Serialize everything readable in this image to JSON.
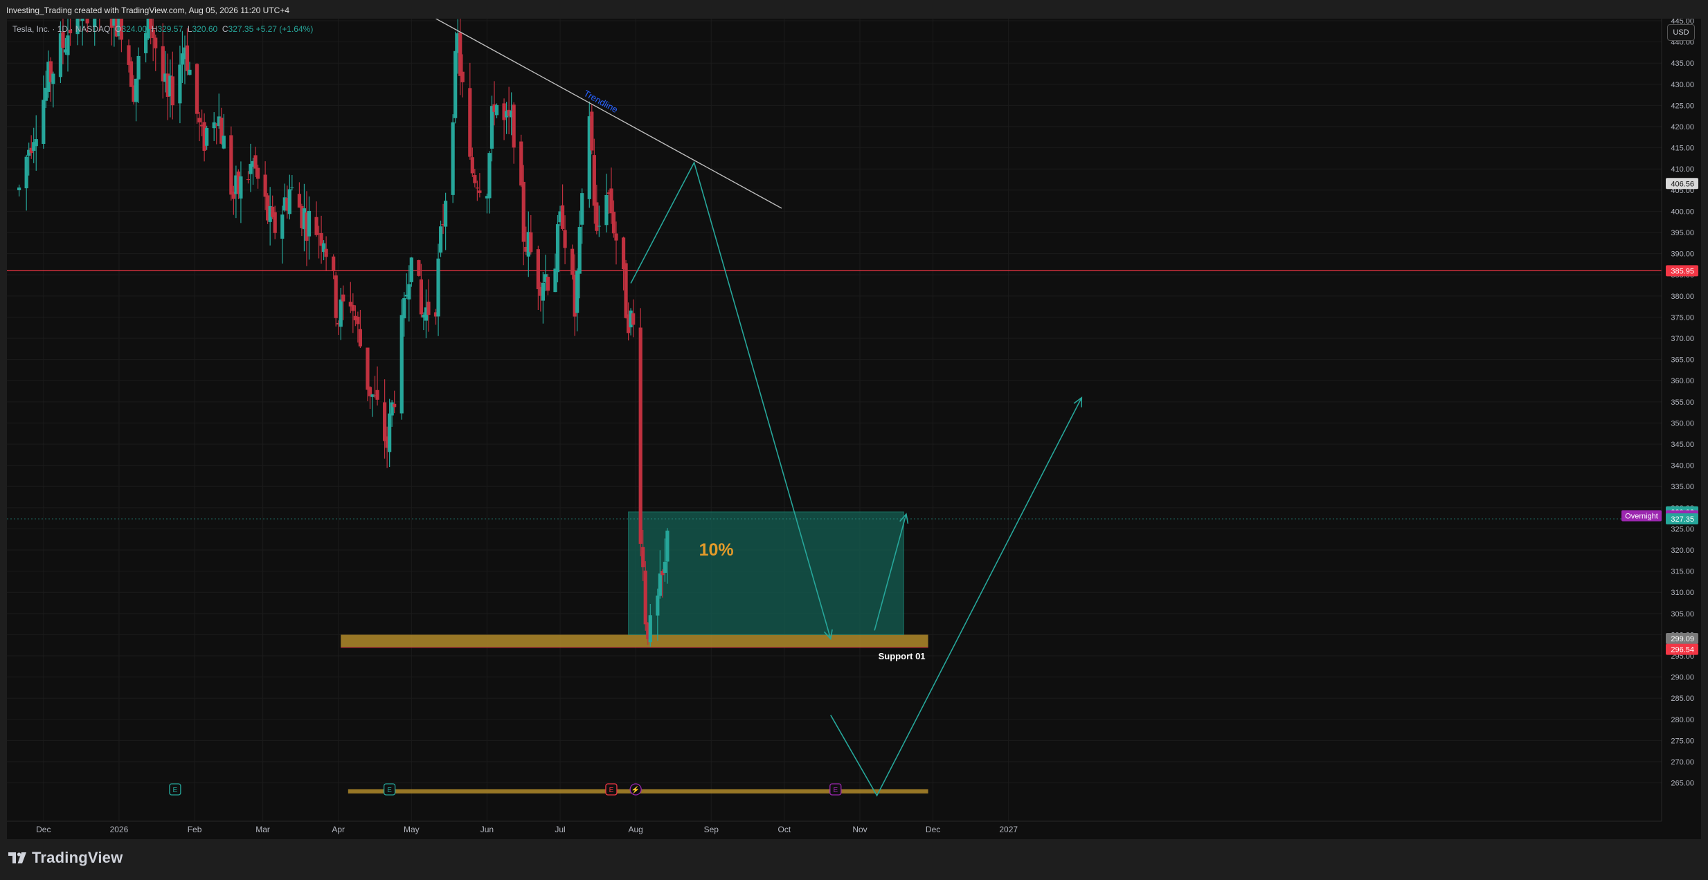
{
  "header": {
    "credit": "Investing_Trading created with TradingView.com, Aug 05, 2026 11:20 UTC+4"
  },
  "legend": {
    "symbol": "Tesla, Inc. · 1D · NASDAQ",
    "open_label": "O",
    "open": "324.00",
    "high_label": "H",
    "high": "329.57",
    "low_label": "L",
    "low": "320.60",
    "close_label": "C",
    "close": "327.35",
    "change": "+5.27 (+1.64%)"
  },
  "currency_button": "USD",
  "footer": {
    "brand": "TradingView"
  },
  "colors": {
    "up": "#26a69a",
    "down": "#c0313f",
    "background": "#0f0f0f",
    "support_zone": "#b08a2a",
    "target_box": "#135e52",
    "arrows": "#26a69a",
    "trendline": "#bdbdbd",
    "overnight_badge": "#9c27b0"
  },
  "chart_data": {
    "type": "candlestick",
    "symbol": "TSLA",
    "interval": "1D",
    "ylim": [
      262,
      445
    ],
    "y_ticks": [
      "445.00",
      "440.00",
      "435.00",
      "430.00",
      "425.00",
      "420.00",
      "415.00",
      "410.00",
      "405.00",
      "400.00",
      "395.00",
      "390.00",
      "385.00",
      "380.00",
      "375.00",
      "370.00",
      "365.00",
      "360.00",
      "355.00",
      "350.00",
      "345.00",
      "340.00",
      "335.00",
      "330.00",
      "325.00",
      "320.00",
      "315.00",
      "310.00",
      "305.00",
      "300.00",
      "295.00",
      "290.00",
      "285.00",
      "280.00",
      "275.00",
      "270.00",
      "265.00"
    ],
    "x_ticks": [
      {
        "label": "Dec",
        "date": "2025-12-01"
      },
      {
        "label": "2026",
        "date": "2026-01-01"
      },
      {
        "label": "Feb",
        "date": "2026-02-01"
      },
      {
        "label": "Mar",
        "date": "2026-03-01"
      },
      {
        "label": "Apr",
        "date": "2026-04-01"
      },
      {
        "label": "May",
        "date": "2026-05-01"
      },
      {
        "label": "Jun",
        "date": "2026-06-01"
      },
      {
        "label": "Jul",
        "date": "2026-07-01"
      },
      {
        "label": "Aug",
        "date": "2026-08-01"
      },
      {
        "label": "Sep",
        "date": "2026-09-01"
      },
      {
        "label": "Oct",
        "date": "2026-10-01"
      },
      {
        "label": "Nov",
        "date": "2026-11-01"
      },
      {
        "label": "Dec",
        "date": "2026-12-01"
      },
      {
        "label": "2027",
        "date": "2027-01-01"
      }
    ],
    "candle_waypoints": [
      {
        "date": "2025-11-21",
        "close": 405
      },
      {
        "date": "2025-11-26",
        "close": 418
      },
      {
        "date": "2025-12-05",
        "close": 434
      },
      {
        "date": "2025-12-15",
        "close": 448
      },
      {
        "date": "2025-12-22",
        "close": 450
      },
      {
        "date": "2026-01-02",
        "close": 445
      },
      {
        "date": "2026-01-07",
        "close": 430
      },
      {
        "date": "2026-01-14",
        "close": 445
      },
      {
        "date": "2026-01-21",
        "close": 425
      },
      {
        "date": "2026-01-28",
        "close": 440
      },
      {
        "date": "2026-02-04",
        "close": 416
      },
      {
        "date": "2026-02-10",
        "close": 425
      },
      {
        "date": "2026-02-17",
        "close": 403
      },
      {
        "date": "2026-02-25",
        "close": 411
      },
      {
        "date": "2026-03-05",
        "close": 395
      },
      {
        "date": "2026-03-12",
        "close": 405
      },
      {
        "date": "2026-03-19",
        "close": 398
      },
      {
        "date": "2026-03-26",
        "close": 395
      },
      {
        "date": "2026-04-01",
        "close": 375
      },
      {
        "date": "2026-04-06",
        "close": 380
      },
      {
        "date": "2026-04-13",
        "close": 360
      },
      {
        "date": "2026-04-21",
        "close": 345
      },
      {
        "date": "2026-04-28",
        "close": 375
      },
      {
        "date": "2026-05-01",
        "close": 394
      },
      {
        "date": "2026-05-05",
        "close": 375
      },
      {
        "date": "2026-05-11",
        "close": 380
      },
      {
        "date": "2026-05-15",
        "close": 405
      },
      {
        "date": "2026-05-20",
        "close": 440
      },
      {
        "date": "2026-05-25",
        "close": 410
      },
      {
        "date": "2026-06-01",
        "close": 407
      },
      {
        "date": "2026-06-04",
        "close": 427
      },
      {
        "date": "2026-06-08",
        "close": 420
      },
      {
        "date": "2026-06-12",
        "close": 420
      },
      {
        "date": "2026-06-16",
        "close": 395
      },
      {
        "date": "2026-06-22",
        "close": 385
      },
      {
        "date": "2026-06-28",
        "close": 385
      },
      {
        "date": "2026-07-02",
        "close": 400
      },
      {
        "date": "2026-07-07",
        "close": 376
      },
      {
        "date": "2026-07-13",
        "close": 424
      },
      {
        "date": "2026-07-16",
        "close": 393
      },
      {
        "date": "2026-07-20",
        "close": 407
      },
      {
        "date": "2026-07-24",
        "close": 394
      },
      {
        "date": "2026-07-28",
        "close": 378
      },
      {
        "date": "2026-07-31",
        "close": 372
      },
      {
        "date": "2026-08-03",
        "close": 326
      },
      {
        "date": "2026-08-05",
        "close": 305
      },
      {
        "date": "2026-08-07",
        "close": 300
      },
      {
        "date": "2026-08-10",
        "close": 307
      },
      {
        "date": "2026-08-13",
        "close": 315
      },
      {
        "date": "2026-08-14",
        "close": 327.35
      }
    ],
    "horizontal_line": {
      "price": 385.95,
      "label": "385.95",
      "color": "#f23645"
    },
    "price_labels": [
      {
        "price": 406.56,
        "label": "406.56",
        "style": "light"
      },
      {
        "price": 385.95,
        "label": "385.95",
        "style": "red"
      },
      {
        "price": 329.02,
        "label": "329.02",
        "style": "green"
      },
      {
        "price": 328.09,
        "label": "328.09",
        "style": "purple",
        "badge": "Overnight"
      },
      {
        "price": 327.35,
        "label": "327.35",
        "style": "green"
      },
      {
        "price": 299.09,
        "label": "299.09",
        "style": "grey"
      },
      {
        "price": 296.54,
        "label": "296.54",
        "style": "red"
      }
    ],
    "trendline": {
      "label": "Trendline",
      "from": {
        "date": "2026-05-11",
        "price": 445.5
      },
      "to": {
        "date": "2026-09-10",
        "price": 407
      }
    },
    "target_box": {
      "label": "10%",
      "from_date": "2026-07-29",
      "to_date": "2026-11-19",
      "top": 329,
      "bottom": 300
    },
    "support_zone": {
      "label": "Support 01",
      "from_date": "2026-04-02",
      "to_date": "2026-11-29",
      "top": 300,
      "bottom": 297
    },
    "bottom_zone": {
      "from_date": "2026-04-05",
      "to_date": "2026-11-29",
      "price": 263
    },
    "forecast_path_1": [
      {
        "date": "2026-07-30",
        "price": 383
      },
      {
        "date": "2026-08-25",
        "price": 411.5
      },
      {
        "date": "2026-10-20",
        "price": 299
      },
      {
        "date": "2026-11-07",
        "price": 301
      },
      {
        "date": "2026-11-20",
        "price": 328.5
      }
    ],
    "forecast_path_2": [
      {
        "date": "2026-10-20",
        "price": 281
      },
      {
        "date": "2026-11-08",
        "price": 262
      },
      {
        "date": "2027-01-31",
        "price": 356
      }
    ],
    "event_markers": [
      {
        "date": "2026-01-24",
        "kind": "E",
        "style": "green"
      },
      {
        "date": "2026-04-22",
        "kind": "E",
        "style": "green"
      },
      {
        "date": "2026-07-22",
        "kind": "E",
        "style": "red"
      },
      {
        "date": "2026-08-01",
        "kind": "⚡",
        "style": "purple"
      },
      {
        "date": "2026-10-22",
        "kind": "E",
        "style": "purple"
      }
    ]
  }
}
